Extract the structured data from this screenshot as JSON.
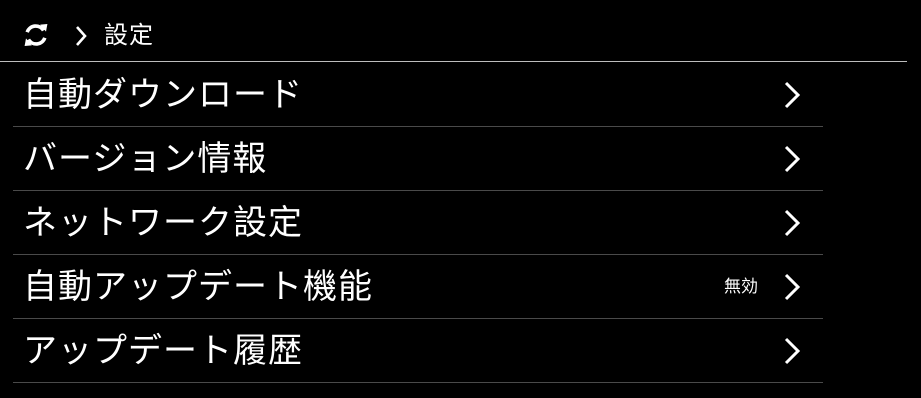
{
  "header": {
    "refresh_icon": "refresh-icon",
    "separator_icon": "chevron-right-icon",
    "title": "設定"
  },
  "menu": {
    "items": [
      {
        "label": "自動ダウンロード",
        "value": ""
      },
      {
        "label": "バージョン情報",
        "value": ""
      },
      {
        "label": "ネットワーク設定",
        "value": ""
      },
      {
        "label": "自動アップデート機能",
        "value": "無効"
      },
      {
        "label": "アップデート履歴",
        "value": ""
      }
    ],
    "chevron_icon": "chevron-right-icon"
  },
  "colors": {
    "background": "#000000",
    "text": "#ffffff",
    "header_rule": "#bdbdbd",
    "row_divider": "#4a4a4a"
  }
}
